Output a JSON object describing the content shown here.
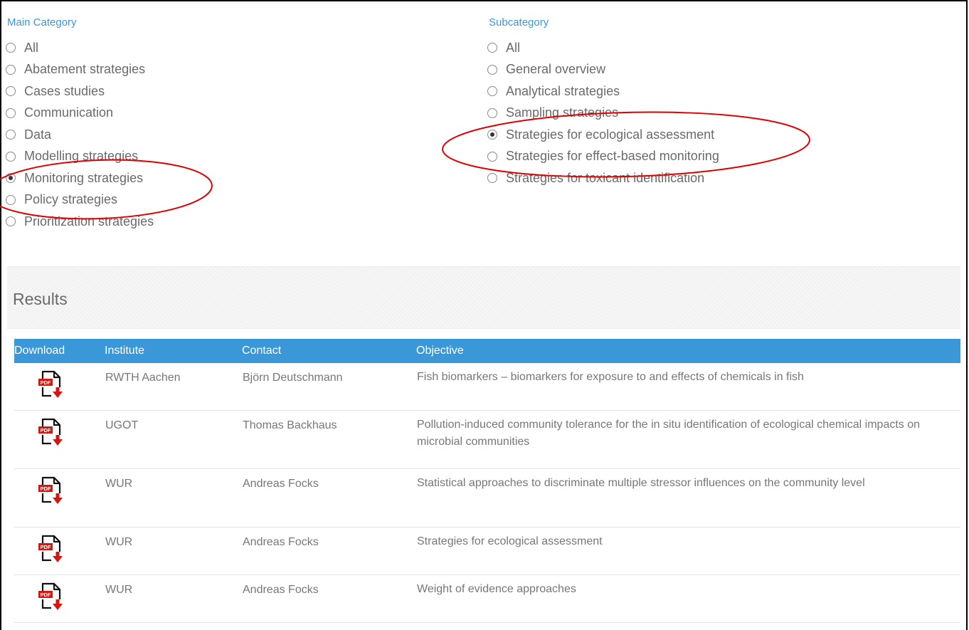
{
  "main_category": {
    "title": "Main Category",
    "options": [
      "All",
      "Abatement strategies",
      "Cases studies",
      "Communication",
      "Data",
      "Modelling strategies",
      "Monitoring strategies",
      "Policy strategies",
      "Prioritization strategies"
    ],
    "selected": "Monitoring strategies"
  },
  "subcategory": {
    "title": "Subcategory",
    "options": [
      "All",
      "General overview",
      "Analytical strategies",
      "Sampling strategies",
      "Strategies for ecological assessment",
      "Strategies for effect-based monitoring",
      "Strategies for toxicant identification"
    ],
    "selected": "Strategies for ecological assessment"
  },
  "results": {
    "title": "Results",
    "columns": {
      "download": "Download",
      "institute": "Institute",
      "contact": "Contact",
      "objective": "Objective"
    },
    "rows": [
      {
        "icon": "pdf-download-icon",
        "institute": "RWTH Aachen",
        "contact": "Björn Deutschmann",
        "objective": "Fish biomarkers – biomarkers for exposure to and effects of chemicals in fish"
      },
      {
        "icon": "pdf-download-icon",
        "institute": "UGOT",
        "contact": "Thomas Backhaus",
        "objective": "Pollution-induced community tolerance for the in situ identification of ecological chemical impacts on microbial communities"
      },
      {
        "icon": "pdf-download-icon",
        "institute": "WUR",
        "contact": "Andreas Focks",
        "objective": "Statistical approaches to discriminate multiple stressor influences on the community level"
      },
      {
        "icon": "pdf-download-icon",
        "institute": "WUR",
        "contact": "Andreas Focks",
        "objective": "Strategies for ecological assessment"
      },
      {
        "icon": "pdf-download-icon",
        "institute": "WUR",
        "contact": "Andreas Focks",
        "objective": "Weight of evidence approaches"
      }
    ]
  },
  "colors": {
    "accent": "#3a98d8",
    "annotation": "#e00000",
    "pdf_red": "#d9140e"
  }
}
